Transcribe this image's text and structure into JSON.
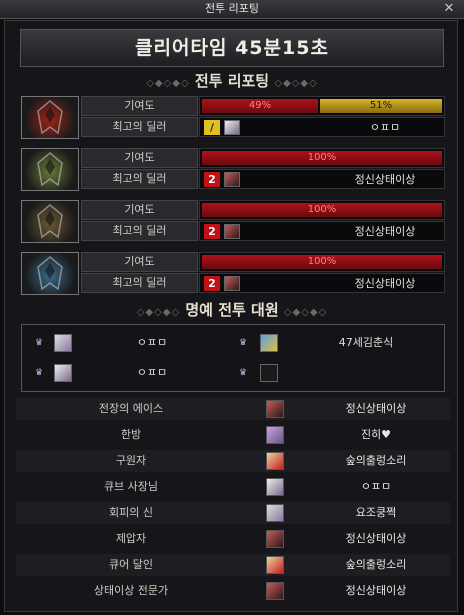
{
  "window": {
    "title": "전투 리포팅",
    "close_glyph": "✕"
  },
  "clear_time": "클리어타임  45분15초",
  "section_battle": "전투 리포팅",
  "section_honor": "명예 전투 대원",
  "row_labels": {
    "contribution": "기여도",
    "top_dealer": "최고의 딜러"
  },
  "bosses": [
    {
      "icon": "red-boss-portrait-icon",
      "color": "#a02418",
      "contribution": [
        {
          "label": "49%",
          "value": 49,
          "color": "red"
        },
        {
          "label": "51%",
          "value": 51,
          "color": "gold"
        }
      ],
      "dealer_rank": "1",
      "dealer_name": "ㅇㅍㅁ"
    },
    {
      "icon": "green-boss-portrait-icon",
      "color": "#6a7a3a",
      "contribution": [
        {
          "label": "100%",
          "value": 100,
          "color": "red"
        }
      ],
      "dealer_rank": "2",
      "dealer_name": "정신상태이상"
    },
    {
      "icon": "bronze-boss-portrait-icon",
      "color": "#6a5a34",
      "contribution": [
        {
          "label": "100%",
          "value": 100,
          "color": "red"
        }
      ],
      "dealer_rank": "2",
      "dealer_name": "정신상태이상"
    },
    {
      "icon": "blue-boss-portrait-icon",
      "color": "#3a6a8a",
      "contribution": [
        {
          "label": "100%",
          "value": 100,
          "color": "red"
        }
      ],
      "dealer_rank": "2",
      "dealer_name": "정신상태이상"
    }
  ],
  "honor_members": [
    {
      "name": "ㅇㅍㅁ"
    },
    {
      "name": "47세김춘식"
    },
    {
      "name": "ㅇㅍㅁ"
    },
    {
      "name": ""
    }
  ],
  "awards": [
    {
      "title": "전장의 에이스",
      "name": "정신상태이상"
    },
    {
      "title": "한방",
      "name": "진히♥"
    },
    {
      "title": "구원자",
      "name": "숲의출렁소리"
    },
    {
      "title": "큐브 사장님",
      "name": "ㅇㅍㅁ"
    },
    {
      "title": "회피의 신",
      "name": "요조쿵쩍"
    },
    {
      "title": "제압자",
      "name": "정신상태이상"
    },
    {
      "title": "큐어 달인",
      "name": "숲의출렁소리"
    },
    {
      "title": "상태이상 전문가",
      "name": "정신상태이상"
    }
  ]
}
